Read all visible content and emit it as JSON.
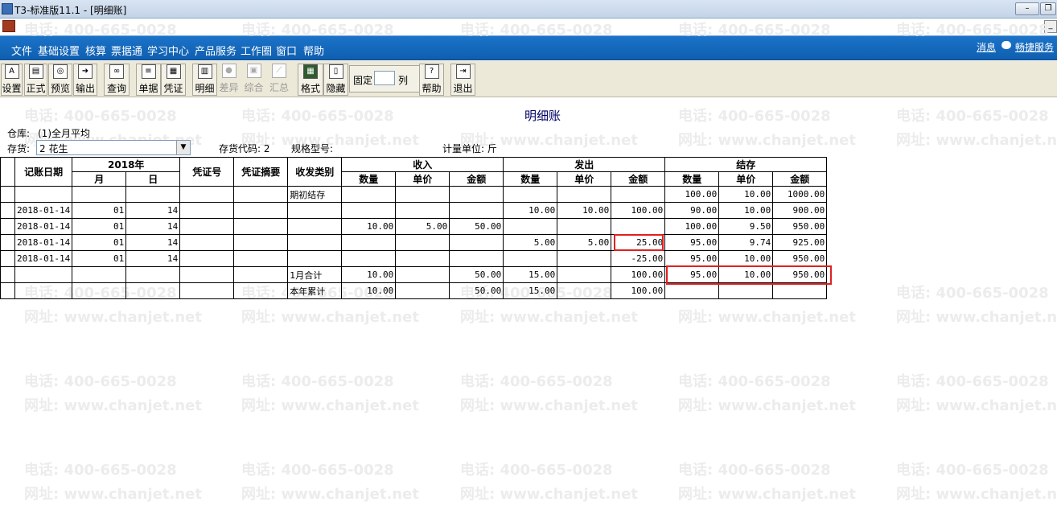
{
  "window": {
    "title": "T3-标准版11.1 - [明细账]"
  },
  "menu": {
    "items": [
      "文件",
      "基础设置",
      "核算",
      "票据通",
      "学习中心",
      "产品服务",
      "工作圈",
      "窗口",
      "帮助"
    ],
    "right": {
      "message": "消息",
      "quick": "畅捷服务"
    }
  },
  "toolbar": {
    "buttons": [
      {
        "label": "设置",
        "icon": "settings-icon",
        "enabled": true
      },
      {
        "label": "正式",
        "icon": "print-icon",
        "enabled": true
      },
      {
        "label": "预览",
        "icon": "preview-icon",
        "enabled": true
      },
      {
        "label": "输出",
        "icon": "export-icon",
        "enabled": true
      },
      {
        "label": "查询",
        "icon": "binoculars-icon",
        "enabled": true
      },
      {
        "label": "单据",
        "icon": "document-icon",
        "enabled": true
      },
      {
        "label": "凭证",
        "icon": "voucher-icon",
        "enabled": true
      },
      {
        "label": "明细",
        "icon": "detail-icon",
        "enabled": true
      },
      {
        "label": "差异",
        "icon": "difference-icon",
        "enabled": false
      },
      {
        "label": "综合",
        "icon": "summary-icon",
        "enabled": false
      },
      {
        "label": "汇总",
        "icon": "chart-icon",
        "enabled": false
      },
      {
        "label": "格式",
        "icon": "format-icon",
        "enabled": true
      },
      {
        "label": "隐藏",
        "icon": "hide-icon",
        "enabled": true
      },
      {
        "label": "帮助",
        "icon": "help-icon",
        "enabled": true
      },
      {
        "label": "退出",
        "icon": "exit-icon",
        "enabled": true
      }
    ],
    "fixed": {
      "label": "固定",
      "value": "",
      "unit": "列"
    }
  },
  "watermark": {
    "phone": "电话: 400-665-0028",
    "site": "网址: www.chanjet.net"
  },
  "report": {
    "title": "明细账",
    "warehouse_label": "仓库:",
    "warehouse_value": "(1)全月平均",
    "stock_label": "存货:",
    "stock_value": "2 花生",
    "stock_code": "存货代码: 2",
    "spec": "规格型号:",
    "unit": "计量单位: 斤"
  },
  "table": {
    "headers": {
      "date": "记账日期",
      "year": "2018年",
      "month": "月",
      "day": "日",
      "voucher_no": "凭证号",
      "voucher_summary": "凭证摘要",
      "category": "收发类别",
      "income": "收入",
      "issue": "发出",
      "balance": "结存",
      "qty": "数量",
      "price": "单价",
      "amount": "金额"
    },
    "rows": [
      [
        "",
        "",
        "",
        "",
        "",
        "期初结存",
        "",
        "",
        "",
        "",
        "",
        "",
        "100.00",
        "10.00",
        "1000.00"
      ],
      [
        "2018-01-14",
        "01",
        "14",
        "",
        "",
        "",
        "",
        "",
        "",
        "10.00",
        "10.00",
        "100.00",
        "90.00",
        "10.00",
        "900.00"
      ],
      [
        "2018-01-14",
        "01",
        "14",
        "",
        "",
        "",
        "10.00",
        "5.00",
        "50.00",
        "",
        "",
        "",
        "100.00",
        "9.50",
        "950.00"
      ],
      [
        "2018-01-14",
        "01",
        "14",
        "",
        "",
        "",
        "",
        "",
        "",
        "5.00",
        "5.00",
        "25.00",
        "95.00",
        "9.74",
        "925.00"
      ],
      [
        "2018-01-14",
        "01",
        "14",
        "",
        "",
        "",
        "",
        "",
        "",
        "",
        "",
        "-25.00",
        "95.00",
        "10.00",
        "950.00"
      ],
      [
        "",
        "",
        "",
        "",
        "",
        "1月合计",
        "10.00",
        "",
        "50.00",
        "15.00",
        "",
        "100.00",
        "95.00",
        "10.00",
        "950.00"
      ],
      [
        "",
        "",
        "",
        "",
        "",
        "本年累计",
        "10.00",
        "",
        "50.00",
        "15.00",
        "",
        "100.00",
        "",
        "",
        ""
      ]
    ]
  },
  "colors": {
    "menubar": "#0f5fb0",
    "highlight": "#e02020"
  }
}
